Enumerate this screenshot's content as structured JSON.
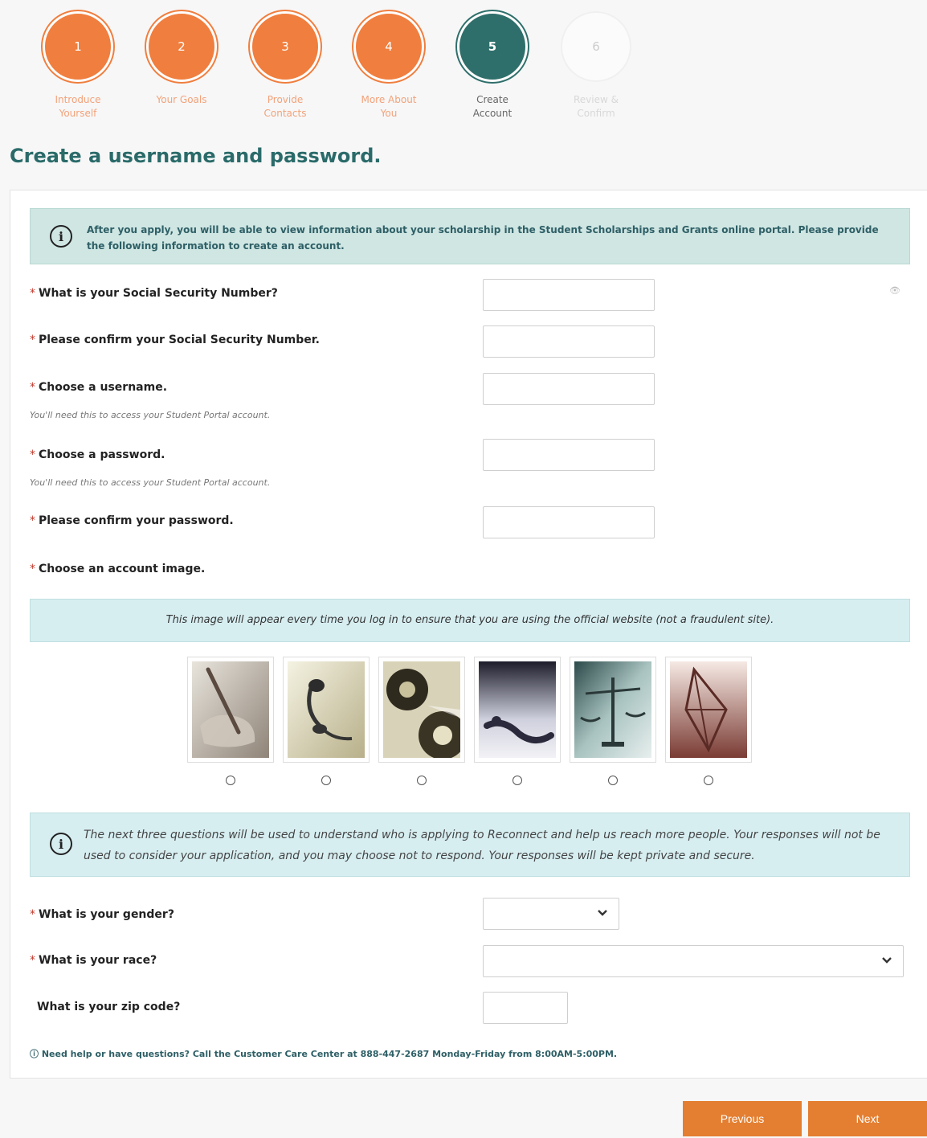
{
  "steps": [
    {
      "num": "1",
      "label_line1": "Introduce",
      "label_line2": "Yourself",
      "state": "done"
    },
    {
      "num": "2",
      "label_line1": "Your Goals",
      "label_line2": "",
      "state": "done"
    },
    {
      "num": "3",
      "label_line1": "Provide",
      "label_line2": "Contacts",
      "state": "done"
    },
    {
      "num": "4",
      "label_line1": "More About",
      "label_line2": "You",
      "state": "done"
    },
    {
      "num": "5",
      "label_line1": "Create",
      "label_line2": "Account",
      "state": "active"
    },
    {
      "num": "6",
      "label_line1": "Review &",
      "label_line2": "Confirm",
      "state": "todo"
    }
  ],
  "page_title": "Create a username and password.",
  "info_top": "After you apply, you will be able to view information about your scholarship in the Student Scholarships and Grants online portal. Please provide the following information to create an account.",
  "required_mark": "*",
  "questions": {
    "ssn": "What is your Social Security Number?",
    "ssn_confirm": "Please confirm your Social Security Number.",
    "username": "Choose a username.",
    "username_hint": "You'll need this to access your Student Portal account.",
    "password": "Choose a password.",
    "password_hint": "You'll need this to access your Student Portal account.",
    "password_confirm": "Please confirm your password.",
    "account_image": "Choose an account image.",
    "gender": "What is your gender?",
    "race": "What is your race?",
    "zip": "What is your zip code?"
  },
  "image_info": "This image will appear every time you log in to ensure that you are using the official website (not a fraudulent site).",
  "account_images": [
    "pen-on-paper",
    "headset",
    "gears",
    "corkscrew",
    "scales",
    "geometric-sculpture"
  ],
  "demographics_info": "The next three questions will be used to understand who is applying to Reconnect and help us reach more people. Your responses will not be used to consider your application, and you may choose not to respond. Your responses will be kept private and secure.",
  "help_text": "Need help or have questions? Call the Customer Care Center at 888-447-2687 Monday-Friday from 8:00AM-5:00PM.",
  "buttons": {
    "previous": "Previous",
    "next": "Next"
  },
  "colors": {
    "orange": "#f07e3e",
    "teal": "#2f6f6b",
    "button": "#e47f31"
  }
}
